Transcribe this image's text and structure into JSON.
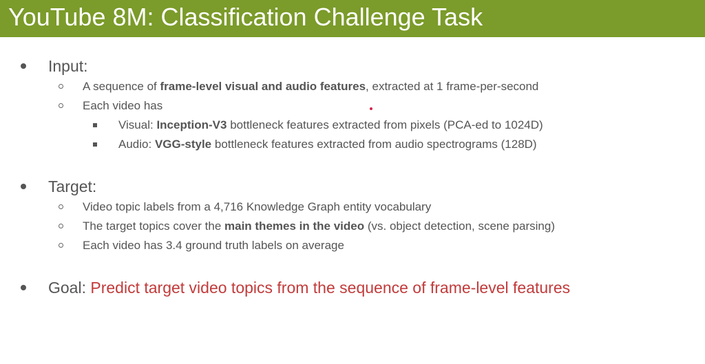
{
  "title": "YouTube 8M: Classification Challenge Task",
  "input": {
    "heading": "Input:",
    "sub1": {
      "pre": "A sequence of ",
      "bold": "frame-level visual and audio features",
      "post": ", extracted at 1 frame-per-second"
    },
    "sub2": "Each video has",
    "visual": {
      "label": "Visual: ",
      "bold": "Inception-V3",
      "post": " bottleneck features extracted from pixels (PCA-ed to 1024D)"
    },
    "audio": {
      "label": "Audio: ",
      "bold": "VGG-style",
      "post": " bottleneck features extracted from audio spectrograms (128D)"
    }
  },
  "target": {
    "heading": "Target:",
    "sub1": "Video topic labels from a 4,716 Knowledge Graph entity vocabulary",
    "sub2": {
      "pre": "The target topics cover the ",
      "bold": "main themes in the video",
      "post": " (vs. object detection, scene parsing)"
    },
    "sub3": "Each video has 3.4 ground truth labels on average"
  },
  "goal": {
    "label": "Goal: ",
    "text": "Predict target video topics from the sequence of frame-level features"
  },
  "colors": {
    "title_bar": "#7b9b2a",
    "goal_text": "#c23b3b",
    "body_text": "#555555"
  }
}
